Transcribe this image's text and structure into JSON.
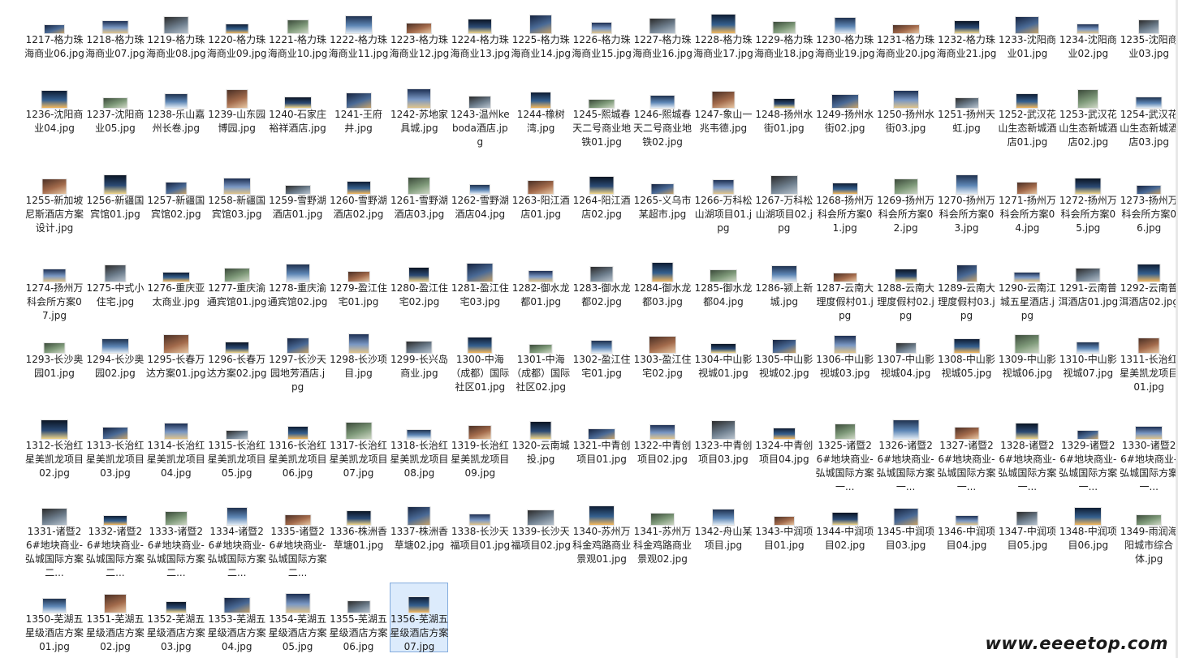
{
  "watermark": "www.eeeetop.com",
  "selected": "1356-芜湖五星级酒店方案07.jpg",
  "rows": [
    [
      "1217-格力珠海商业06.jpg",
      "1218-格力珠海商业07.jpg",
      "1219-格力珠海商业08.jpg",
      "1220-格力珠海商业09.jpg",
      "1221-格力珠海商业10.jpg",
      "1222-格力珠海商业11.jpg",
      "1223-格力珠海商业12.jpg",
      "1224-格力珠海商业13.jpg",
      "1225-格力珠海商业14.jpg",
      "1226-格力珠海商业15.jpg",
      "1227-格力珠海商业16.jpg",
      "1228-格力珠海商业17.jpg",
      "1229-格力珠海商业18.jpg",
      "1230-格力珠海商业19.jpg",
      "1231-格力珠海商业20.jpg",
      "1232-格力珠海商业21.jpg",
      "1233-沈阳商业01.jpg",
      "1234-沈阳商业02.jpg",
      "1235-沈阳商业03.jpg"
    ],
    [
      "1236-沈阳商业04.jpg",
      "1237-沈阳商业05.jpg",
      "1238-乐山嘉州长卷.jpg",
      "1239-山东园博园.jpg",
      "1240-石家庄裕祥酒店.jpg",
      "1241-王府井.jpg",
      "1242-苏地家具城.jpg",
      "1243-温州keboda酒店.jpg",
      "1244-橡树湾.jpg",
      "1245-熙城春天二号商业地铁01.jpg",
      "1246-熙城春天二号商业地铁02.jpg",
      "1247-象山一兆韦德.jpg",
      "1248-扬州水街01.jpg",
      "1249-扬州水街02.jpg",
      "1250-扬州水街03.jpg",
      "1251-扬州天虹.jpg",
      "1252-武汉花山生态新城酒店01.jpg",
      "1253-武汉花山生态新城酒店02.jpg",
      "1254-武汉花山生态新城酒店03.jpg"
    ],
    [
      "1255-新加坡尼斯酒店方案设计.jpg",
      "1256-新疆国宾馆01.jpg",
      "1257-新疆国宾馆02.jpg",
      "1258-新疆国宾馆03.jpg",
      "1259-雪野湖酒店01.jpg",
      "1260-雪野湖酒店02.jpg",
      "1261-雪野湖酒店03.jpg",
      "1262-雪野湖酒店04.jpg",
      "1263-阳江酒店01.jpg",
      "1264-阳江酒店02.jpg",
      "1265-义乌市某超市.jpg",
      "1266-万科松山湖项目01.jpg",
      "1267-万科松山湖项目02.jpg",
      "1268-扬州万科会所方案01.jpg",
      "1269-扬州万科会所方案02.jpg",
      "1270-扬州万科会所方案03.jpg",
      "1271-扬州万科会所方案04.jpg",
      "1272-扬州万科会所方案05.jpg",
      "1273-扬州万科会所方案06.jpg"
    ],
    [
      "1274-扬州万科会所方案07.jpg",
      "1275-中式小住宅.jpg",
      "1276-重庆亚太商业.jpg",
      "1277-重庆渝通宾馆01.jpg",
      "1278-重庆渝通宾馆02.jpg",
      "1279-盈江住宅01.jpg",
      "1280-盈江住宅02.jpg",
      "1281-盈江住宅03.jpg",
      "1282-御水龙都01.jpg",
      "1283-御水龙都02.jpg",
      "1284-御水龙都03.jpg",
      "1285-御水龙都04.jpg",
      "1286-颍上新城.jpg",
      "1287-云南大理度假村01.jpg",
      "1288-云南大理度假村02.jpg",
      "1289-云南大理度假村03.jpg",
      "1290-云南江城五星酒店.jpg",
      "1291-云南普洱酒店01.jpg",
      "1292-云南普洱酒店02.jpg"
    ],
    [
      "1293-长沙奥园01.jpg",
      "1294-长沙奥园02.jpg",
      "1295-长春万达方案01.jpg",
      "1296-长春万达方案02.jpg",
      "1297-长沙天园地芳酒店.jpg",
      "1298-长沙项目.jpg",
      "1299-长兴岛商业.jpg",
      "1300-中海（成都）国际社区01.jpg",
      "1301-中海（成都）国际社区02.jpg",
      "1302-盈江住宅01.jpg",
      "1303-盈江住宅02.jpg",
      "1304-中山影视城01.jpg",
      "1305-中山影视城02.jpg",
      "1306-中山影视城03.jpg",
      "1307-中山影视城04.jpg",
      "1308-中山影视城05.jpg",
      "1309-中山影视城06.jpg",
      "1310-中山影视城07.jpg",
      "1311-长治红星美凯龙项目01.jpg"
    ],
    [
      "1312-长治红星美凯龙项目02.jpg",
      "1313-长治红星美凯龙项目03.jpg",
      "1314-长治红星美凯龙项目04.jpg",
      "1315-长治红星美凯龙项目05.jpg",
      "1316-长治红星美凯龙项目06.jpg",
      "1317-长治红星美凯龙项目07.jpg",
      "1318-长治红星美凯龙项目08.jpg",
      "1319-长治红星美凯龙项目09.jpg",
      "1320-云南城投.jpg",
      "1321-中青创项目01.jpg",
      "1322-中青创项目02.jpg",
      "1323-中青创项目03.jpg",
      "1324-中青创项目04.jpg",
      "1325-诸暨26#地块商业-弘城国际方案一...",
      "1326-诸暨26#地块商业-弘城国际方案一...",
      "1327-诸暨26#地块商业-弘城国际方案一...",
      "1328-诸暨26#地块商业-弘城国际方案一...",
      "1329-诸暨26#地块商业-弘城国际方案一...",
      "1330-诸暨26#地块商业-弘城国际方案一..."
    ],
    [
      "1331-诸暨26#地块商业-弘城国际方案二...",
      "1332-诸暨26#地块商业-弘城国际方案二...",
      "1333-诸暨26#地块商业-弘城国际方案二...",
      "1334-诸暨26#地块商业-弘城国际方案二...",
      "1335-诸暨26#地块商业-弘城国际方案二...",
      "1336-株洲香草塘01.jpg",
      "1337-株洲香草塘02.jpg",
      "1338-长沙天福项目01.jpg",
      "1339-长沙天福项目02.jpg",
      "1340-苏州万科金鸡路商业景观01.jpg",
      "1341-苏州万科金鸡路商业景观02.jpg",
      "1342-舟山某项目.jpg",
      "1343-中润项目01.jpg",
      "1344-中润项目02.jpg",
      "1345-中润项目03.jpg",
      "1346-中润项目04.jpg",
      "1347-中润项目05.jpg",
      "1348-中润项目06.jpg",
      "1349-雨润海阳城市综合体.jpg"
    ],
    [
      "1350-芜湖五星级酒店方案01.jpg",
      "1351-芜湖五星级酒店方案02.jpg",
      "1352-芜湖五星级酒店方案03.jpg",
      "1353-芜湖五星级酒店方案04.jpg",
      "1354-芜湖五星级酒店方案05.jpg",
      "1355-芜湖五星级酒店方案06.jpg",
      "1356-芜湖五星级酒店方案07.jpg"
    ]
  ]
}
